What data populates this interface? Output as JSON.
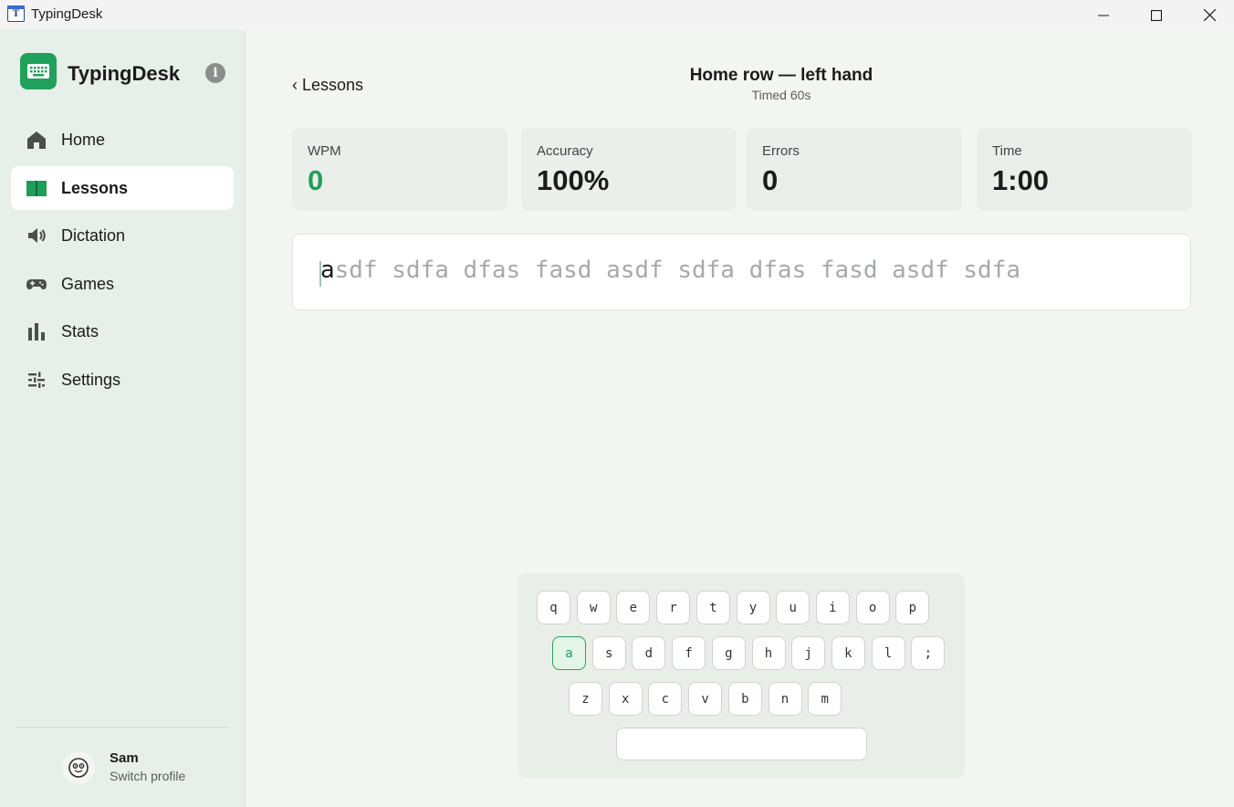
{
  "window": {
    "title": "TypingDesk",
    "icon_letter": "T",
    "controls": [
      "minimize-icon",
      "maximize-icon",
      "close-icon"
    ]
  },
  "sidebar": {
    "brand": "TypingDesk",
    "brand_icon": "keyboard-icon",
    "info_icon": "info-icon",
    "info_glyph": "i",
    "items": [
      {
        "label": "Home",
        "icon": "home-icon",
        "active": false
      },
      {
        "label": "Lessons",
        "icon": "book-icon",
        "active": true
      },
      {
        "label": "Dictation",
        "icon": "speaker-icon",
        "active": false
      },
      {
        "label": "Games",
        "icon": "gamepad-icon",
        "active": false
      },
      {
        "label": "Stats",
        "icon": "bar-chart-icon",
        "active": false
      },
      {
        "label": "Settings",
        "icon": "sliders-icon",
        "active": false
      }
    ],
    "profile": {
      "name": "Sam",
      "subtitle": "Switch profile",
      "avatar_icon": "smiley-avatar-icon"
    }
  },
  "header": {
    "back_label": "‹ Lessons",
    "title": "Home row — left hand",
    "subtitle": "Timed 60s"
  },
  "stats": [
    {
      "label": "WPM",
      "value": "0",
      "accent": "#1f9e58"
    },
    {
      "label": "Accuracy",
      "value": "100%"
    },
    {
      "label": "Errors",
      "value": "0"
    },
    {
      "label": "Time",
      "value": "1:00"
    }
  ],
  "practice": {
    "current_char": "a",
    "remaining_text": "sdf sdfa dfas fasd asdf sdfa dfas fasd asdf sdfa"
  },
  "keyboard": {
    "rows": [
      [
        "q",
        "w",
        "e",
        "r",
        "t",
        "y",
        "u",
        "i",
        "o",
        "p"
      ],
      [
        "a",
        "s",
        "d",
        "f",
        "g",
        "h",
        "j",
        "k",
        "l",
        ";"
      ],
      [
        "z",
        "x",
        "c",
        "v",
        "b",
        "n",
        "m"
      ]
    ],
    "highlighted_key": "a",
    "accent_color": "#1f9e58"
  }
}
